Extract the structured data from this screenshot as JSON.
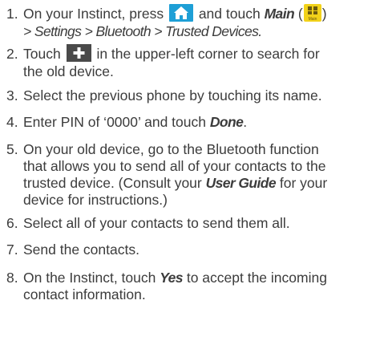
{
  "steps": [
    {
      "num": "1.",
      "t1": "On your Instinct, press",
      "t2": "and touch",
      "main_label": "Main",
      "paren_open": "(",
      "main_icon_caption": "Main",
      "paren_close": ")",
      "path": "> Settings > Bluetooth > Trusted Devices."
    },
    {
      "num": "2.",
      "t1": "Touch",
      "t2": "in the upper-left corner to search for",
      "t3": "the old device."
    },
    {
      "num": "3.",
      "t1": "Select the previous phone by touching its name."
    },
    {
      "num": "4.",
      "t1": "Enter PIN of ‘0000’ and touch",
      "done": "Done",
      "t2": "."
    },
    {
      "num": "5.",
      "l1": "On your old device, go to the Bluetooth function",
      "l2": "that allows you to send all of your contacts to the",
      "l3a": "trusted device. (Consult your",
      "guide": "User Guide",
      "l3b": "for your",
      "l4": "device for instructions.)"
    },
    {
      "num": "6.",
      "t1": "Select all of your contacts to send them all."
    },
    {
      "num": "7.",
      "t1": "Send the contacts."
    },
    {
      "num": "8.",
      "t1": "On the Instinct, touch",
      "yes": "Yes",
      "t2": "to accept the incoming",
      "l2": "contact information."
    }
  ],
  "icons": {
    "home": "home-icon",
    "plus": "plus-icon",
    "main": "main-menu-icon"
  },
  "colors": {
    "home_bg": "#1e9fd6",
    "plus_bg": "#4a4a4a",
    "main_bg": "#f2d21a",
    "text": "#3c3c3c"
  }
}
